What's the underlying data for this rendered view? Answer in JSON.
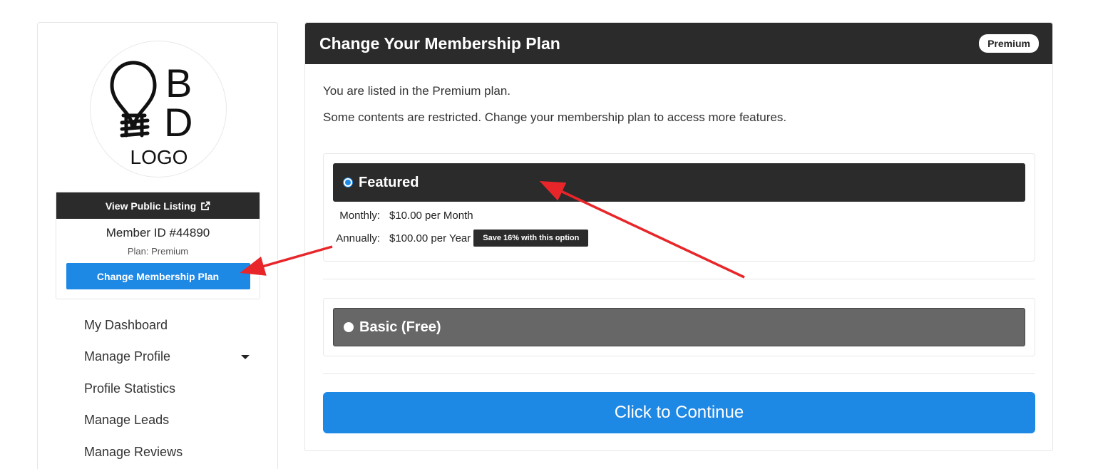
{
  "sidebar": {
    "logo": {
      "letter_top": "B",
      "letter_bottom": "D",
      "caption": "LOGO"
    },
    "view_listing_label": "View Public Listing",
    "member_id": "Member ID #44890",
    "plan_line": "Plan: Premium",
    "change_plan_label": "Change Membership Plan",
    "nav": [
      {
        "label": "My Dashboard"
      },
      {
        "label": "Manage Profile"
      },
      {
        "label": "Profile Statistics"
      },
      {
        "label": "Manage Leads"
      },
      {
        "label": "Manage Reviews"
      }
    ]
  },
  "panel": {
    "title": "Change Your Membership Plan",
    "badge": "Premium",
    "listed_text": "You are listed in the Premium plan.",
    "restricted_text": "Some contents are restricted. Change your membership plan to access more features.",
    "plans": [
      {
        "name": "Featured",
        "selected": true,
        "monthly_label": "Monthly:",
        "monthly_price": "$10.00 per Month",
        "annual_label": "Annually:",
        "annual_price": "$100.00 per Year",
        "save_note": "Save 16% with this option"
      },
      {
        "name": "Basic (Free)",
        "selected": false
      }
    ],
    "continue_label": "Click to Continue"
  },
  "colors": {
    "accent": "#1e88e5",
    "dark": "#2b2b2b",
    "basic_header": "#676767",
    "annotation_arrow": "#e8262a"
  },
  "icons": [
    "external-link-icon",
    "caret-down-icon",
    "lightbulb-icon"
  ]
}
